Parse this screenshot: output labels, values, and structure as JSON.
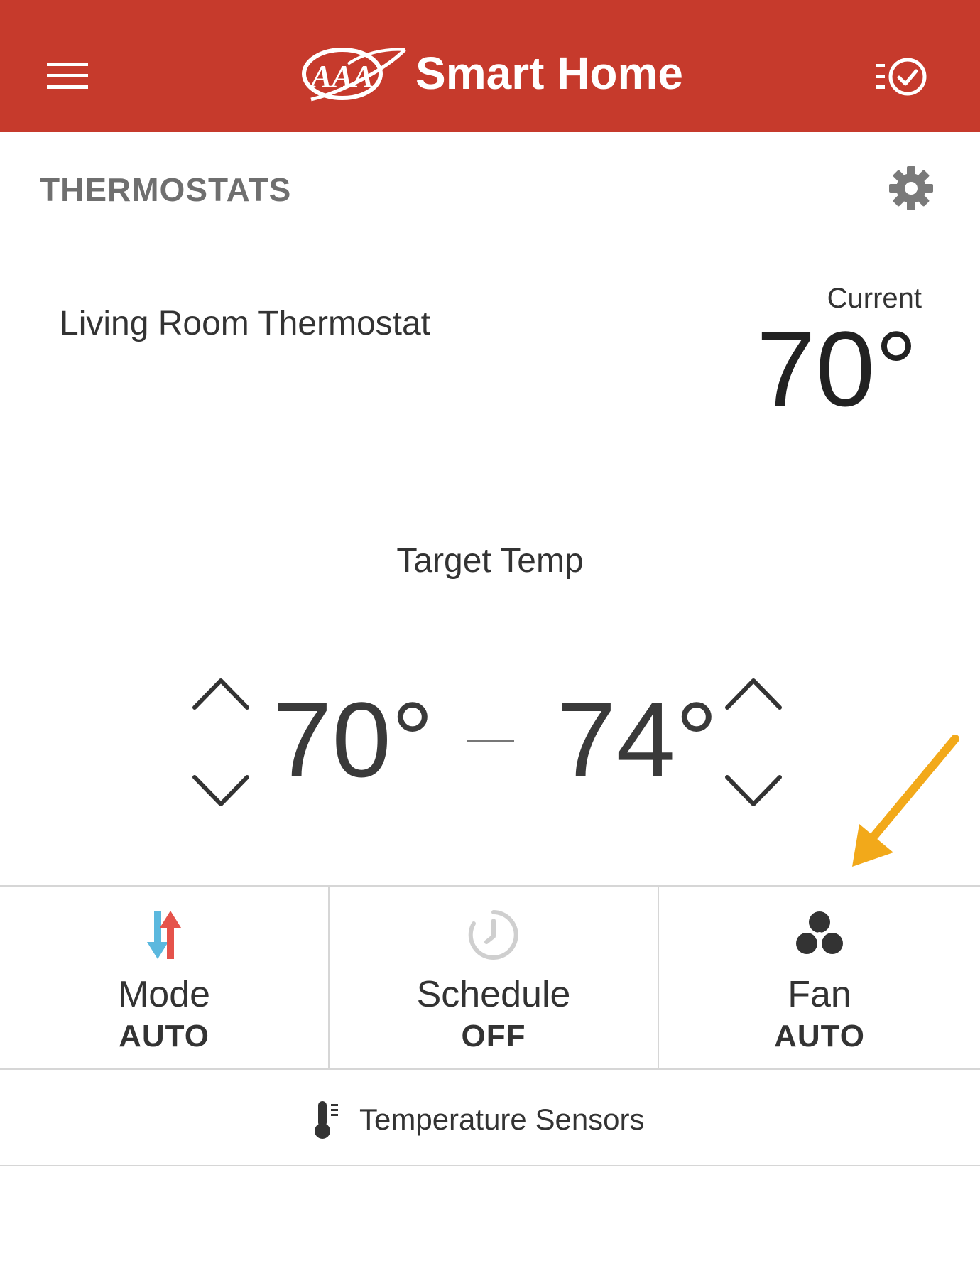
{
  "header": {
    "logo_text": "AAA",
    "brand": "Smart Home"
  },
  "section": {
    "title": "THERMOSTATS"
  },
  "thermostat": {
    "name": "Living Room Thermostat",
    "current_label": "Current",
    "current_value": "70°",
    "target_label": "Target Temp",
    "target_low": "70°",
    "target_high": "74°"
  },
  "tiles": {
    "mode": {
      "label": "Mode",
      "value": "AUTO"
    },
    "schedule": {
      "label": "Schedule",
      "value": "OFF"
    },
    "fan": {
      "label": "Fan",
      "value": "AUTO"
    }
  },
  "sensors": {
    "label": "Temperature Sensors"
  },
  "colors": {
    "header_bg": "#c63a2c",
    "mode_cool": "#5bb8de",
    "mode_heat": "#e5534b",
    "annotation_arrow": "#f2a91a"
  },
  "icons": {
    "menu": "hamburger-menu-icon",
    "tasks": "checklist-icon",
    "settings": "gear-icon",
    "mode": "heat-cool-arrows-icon",
    "schedule": "clock-icon",
    "fan": "fan-icon",
    "sensors": "thermometer-icon"
  }
}
